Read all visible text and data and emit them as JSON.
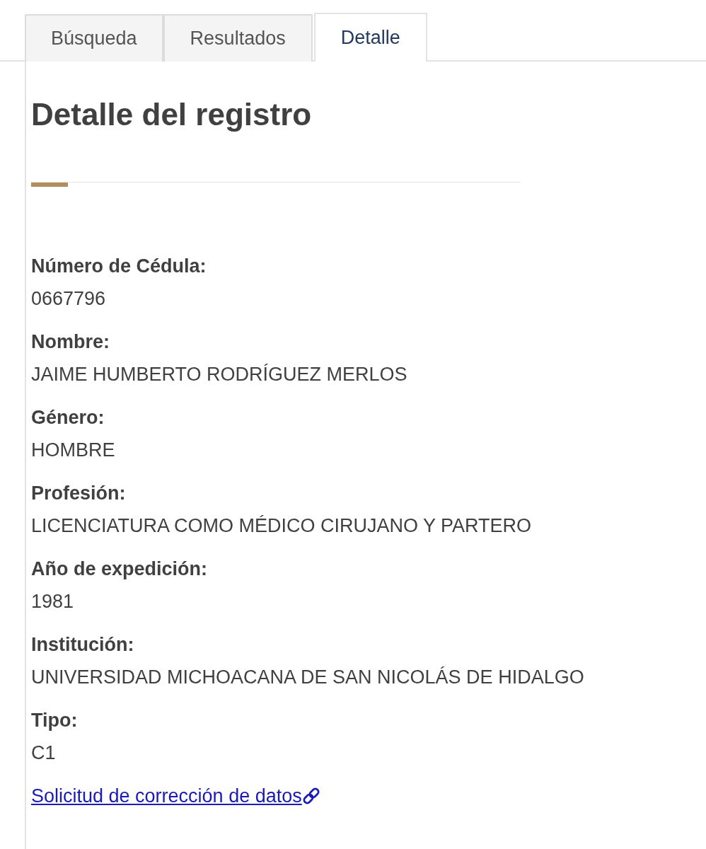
{
  "tabs": [
    {
      "label": "Búsqueda",
      "selected": false
    },
    {
      "label": "Resultados",
      "selected": false
    },
    {
      "label": "Detalle",
      "selected": true
    }
  ],
  "heading": "Detalle del registro",
  "fields": [
    {
      "label": "Número de Cédula:",
      "value": "0667796"
    },
    {
      "label": "Nombre:",
      "value": "JAIME HUMBERTO RODRÍGUEZ MERLOS"
    },
    {
      "label": "Género:",
      "value": "HOMBRE"
    },
    {
      "label": "Profesión:",
      "value": "LICENCIATURA COMO MÉDICO CIRUJANO Y PARTERO"
    },
    {
      "label": "Año de expedición:",
      "value": "1981"
    },
    {
      "label": "Institución:",
      "value": "UNIVERSIDAD MICHOACANA DE SAN NICOLÁS DE HIDALGO"
    },
    {
      "label": "Tipo:",
      "value": "C1"
    }
  ],
  "link": {
    "label": "Solicitud de corrección de datos"
  }
}
